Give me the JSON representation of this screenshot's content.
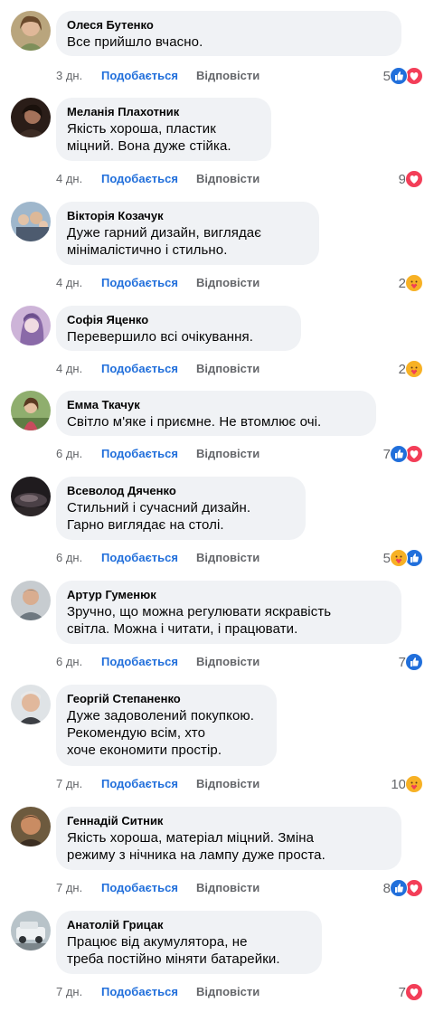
{
  "labels": {
    "like": "Подобається",
    "reply": "Відповісти"
  },
  "colors": {
    "like_blue": "#216fdb",
    "heart_red": "#f33e58",
    "care_yellow": "#f7b125",
    "bubble_bg": "#f0f2f5",
    "meta_gray": "#65676b"
  },
  "comments": [
    {
      "author": "Олеся Бутенко",
      "text": "Все прийшло вчасно.",
      "time": "3 дн.",
      "reactions_count": "5",
      "reactions": [
        "like-icon",
        "heart-icon"
      ]
    },
    {
      "author": "Меланія Плахотник",
      "text": "Якість хороша, пластик\nміцний. Вона дуже стійка.",
      "time": "4 дн.",
      "reactions_count": "9",
      "reactions": [
        "heart-icon"
      ]
    },
    {
      "author": "Вікторія Козачук",
      "text": "Дуже гарний дизайн, виглядає\nмінімалістично і стильно.",
      "time": "4 дн.",
      "reactions_count": "2",
      "reactions": [
        "care-icon"
      ]
    },
    {
      "author": "Софія Яценко",
      "text": "Перевершило всі очікування.",
      "time": "4 дн.",
      "reactions_count": "2",
      "reactions": [
        "care-icon"
      ]
    },
    {
      "author": "Емма Ткачук",
      "text": "Світло м'яке і приємне. Не втомлює очі.",
      "time": "6 дн.",
      "reactions_count": "7",
      "reactions": [
        "like-icon",
        "heart-icon"
      ]
    },
    {
      "author": "Всеволод Дяченко",
      "text": "Стильний і сучасний дизайн.\nГарно виглядає на столі.",
      "time": "6 дн.",
      "reactions_count": "5",
      "reactions": [
        "care-icon",
        "like-icon"
      ]
    },
    {
      "author": "Артур Гуменюк",
      "text": "Зручно, що можна регулювати яскравість\nсвітла. Можна і читати, і працювати.",
      "time": "6 дн.",
      "reactions_count": "7",
      "reactions": [
        "like-icon"
      ]
    },
    {
      "author": "Георгій Степаненко",
      "text": "Дуже задоволений покупкою.\nРекомендую всім, хто\nхоче економити простір.",
      "time": "7 дн.",
      "reactions_count": "10",
      "reactions": [
        "care-icon"
      ]
    },
    {
      "author": "Геннадій Ситник",
      "text": "Якість хороша, матеріал міцний. Зміна\nрежиму з нічника на лампу дуже проста.",
      "time": "7 дн.",
      "reactions_count": "8",
      "reactions": [
        "like-icon",
        "heart-icon"
      ]
    },
    {
      "author": "Анатолій Грицак",
      "text": "Працює від акумулятора, не\nтреба постійно міняти батарейки.",
      "time": "7 дн.",
      "reactions_count": "7",
      "reactions": [
        "heart-icon"
      ]
    }
  ]
}
